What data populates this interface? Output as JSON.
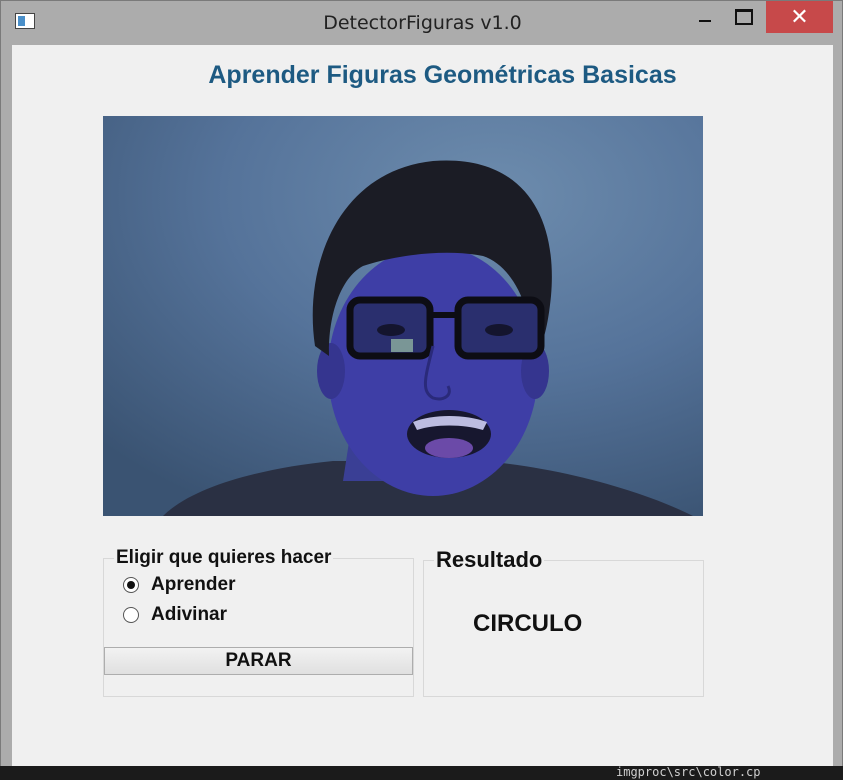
{
  "window": {
    "title": "DetectorFiguras v1.0",
    "close_glyph": "✕",
    "icons": {
      "app": "app-icon",
      "minimize": "minimize-icon",
      "maximize": "maximize-icon",
      "close": "close-icon"
    }
  },
  "app": {
    "heading": "Aprender Figuras Geométricas Basicas",
    "heading_color": "#1d5a82"
  },
  "mode_group": {
    "title": "Eligir que quieres hacer",
    "options": [
      {
        "label": "Aprender",
        "checked": true
      },
      {
        "label": "Adivinar",
        "checked": false
      }
    ],
    "stop_button": "PARAR"
  },
  "result_group": {
    "title": "Resultado",
    "value": "CIRCULO"
  },
  "background_text": "imgproc\\src\\color.cp",
  "colors": {
    "close_button": "#c7494a",
    "client_bg": "#f0f0f0"
  }
}
